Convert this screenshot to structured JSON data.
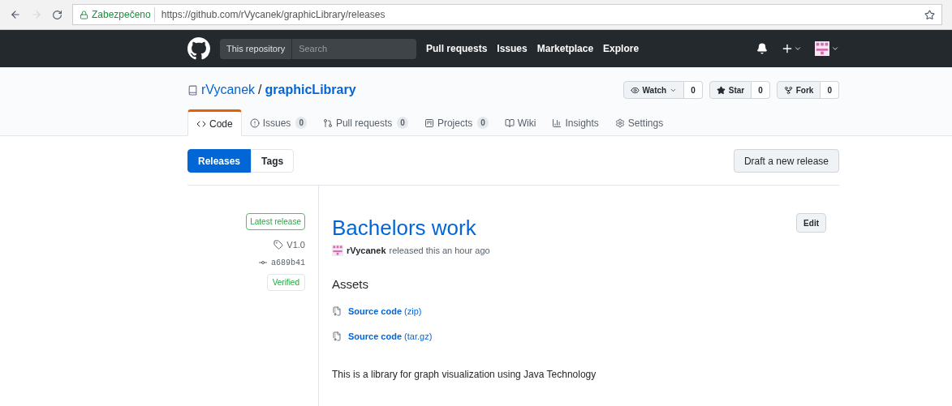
{
  "browser": {
    "security": "Zabezpečeno",
    "url": "https://github.com/rVycanek/graphicLibrary/releases"
  },
  "header": {
    "scope": "This repository",
    "search_placeholder": "Search",
    "nav": [
      "Pull requests",
      "Issues",
      "Marketplace",
      "Explore"
    ]
  },
  "repo": {
    "owner": "rVycanek",
    "separator": "/",
    "name": "graphicLibrary",
    "actions": [
      {
        "kind": "watch",
        "label": "Watch",
        "count": "0"
      },
      {
        "kind": "star",
        "label": "Star",
        "count": "0"
      },
      {
        "kind": "fork",
        "label": "Fork",
        "count": "0"
      }
    ]
  },
  "tabs": [
    {
      "kind": "code",
      "label": "Code",
      "selected": true
    },
    {
      "kind": "issues",
      "label": "Issues",
      "count": "0",
      "selected": false
    },
    {
      "kind": "pulls",
      "label": "Pull requests",
      "count": "0",
      "selected": false
    },
    {
      "kind": "projects",
      "label": "Projects",
      "count": "0",
      "selected": false
    },
    {
      "kind": "wiki",
      "label": "Wiki",
      "selected": false
    },
    {
      "kind": "insights",
      "label": "Insights",
      "selected": false
    },
    {
      "kind": "settings",
      "label": "Settings",
      "selected": false
    }
  ],
  "subnav": [
    {
      "label": "Releases",
      "selected": true
    },
    {
      "label": "Tags",
      "selected": false
    }
  ],
  "draft_button": "Draft a new release",
  "release": {
    "badge": "Latest release",
    "tag": "V1.0",
    "commit": "a689b41",
    "verified": "Verified",
    "title": "Bachelors work",
    "edit": "Edit",
    "author": "rVycanek",
    "meta": "released this an hour ago",
    "assets_heading": "Assets",
    "assets": [
      {
        "label": "Source code",
        "ext": "(zip)"
      },
      {
        "label": "Source code",
        "ext": "(tar.gz)"
      }
    ],
    "description": "This is a library for graph visualization using Java Technology"
  }
}
